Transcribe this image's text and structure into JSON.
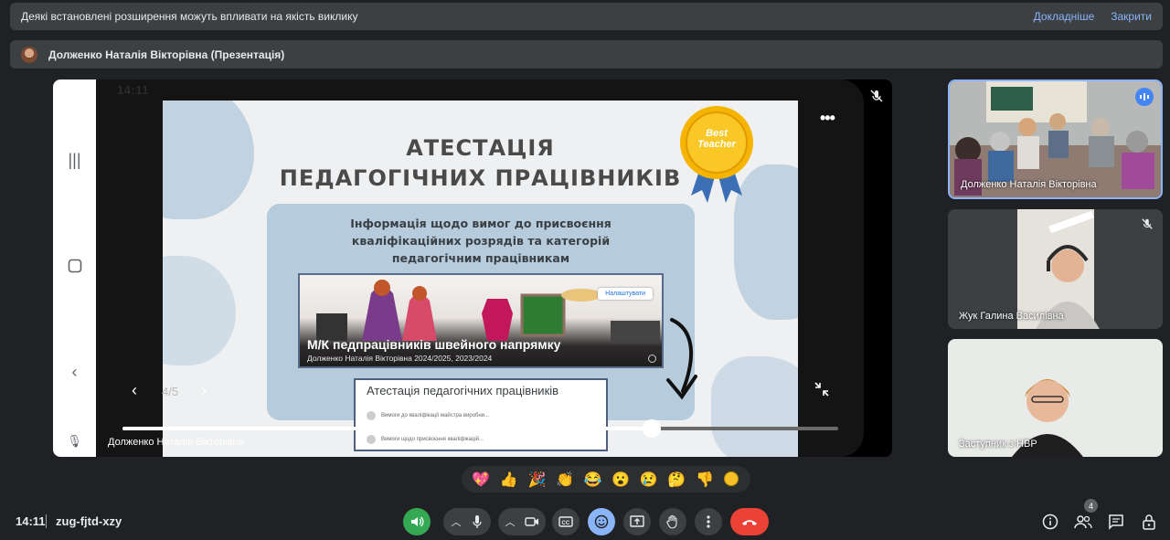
{
  "notice": {
    "message": "Деякі встановлені розширення можуть впливати на якість виклику",
    "details": "Докладніше",
    "close": "Закрити"
  },
  "presenter": {
    "label": "Долженко Наталія Вікторівна (Презентація)"
  },
  "phone": {
    "status_time": "14:11"
  },
  "slide": {
    "title_line1": "АТЕСТАЦІЯ",
    "title_line2": "ПЕДАГОГІЧНИХ ПРАЦІВНИКІВ",
    "info_line1": "Інформація щодо вимог до присвоєння",
    "info_line2": "кваліфікаційних розрядів та категорій",
    "info_line3": "педагогічним працівникам",
    "badge_text": "Best Teacher",
    "card_title": "М/К педпрацівників швейного напрямку",
    "card_subtitle": "Долженко Наталія Вікторівна 2024/2025, 2023/2024",
    "card_button": "Налаштувати",
    "sub_title": "Атестація педагогічних працівників",
    "sub_row1": "Вимоги до кваліфікації майстра виробни...",
    "sub_row2": "Вимоги щодо присвоєння кваліфікацій..."
  },
  "controls": {
    "page_counter": "4/5",
    "progress": 0.74
  },
  "stage_name": "Долженко Наталія Вікторівна",
  "participants": [
    {
      "name": "Долженко Наталія Вікторівна"
    },
    {
      "name": "Жук Галина Василівна"
    },
    {
      "name": "Заступник з НВР"
    }
  ],
  "reactions": [
    "💖",
    "👍",
    "🎉",
    "👏",
    "😂",
    "😮",
    "😢",
    "🤔",
    "👎"
  ],
  "bottom": {
    "time": "14:11",
    "meeting_code": "zug-fjtd-xzy",
    "participant_count": "4"
  },
  "colors": {
    "background": "#202124",
    "accent": "#8ab4f8",
    "end_call": "#ea4335",
    "audio_on": "#34a853"
  }
}
